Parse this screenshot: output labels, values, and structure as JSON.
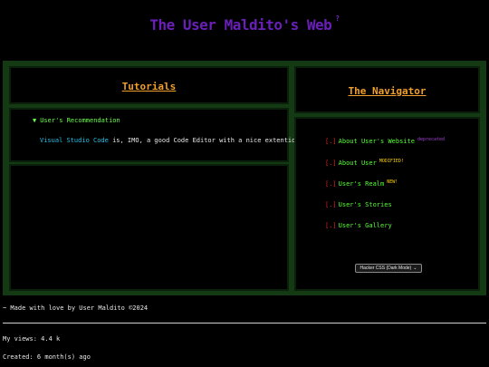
{
  "header": {
    "title": "The User Maldito's Web",
    "sup": "?"
  },
  "tutorials": {
    "title": "Tutorials",
    "details_summary": "User's Recommendation",
    "rec_link": "Visual Studio Code",
    "rec_rest": " is, IMO, a good Code Editor with a nice extention as"
  },
  "navigator": {
    "title": "The Navigator",
    "items": [
      {
        "bracket": "[.]",
        "label": "About User's Website",
        "tag": "deprecated"
      },
      {
        "bracket": "[.]",
        "label": "About User",
        "tag": "MODIFIED!"
      },
      {
        "bracket": "[.]",
        "label": "User's Realm",
        "tag": "NEW!"
      },
      {
        "bracket": "[.]",
        "label": "User's Stories",
        "tag": ""
      },
      {
        "bracket": "[.]",
        "label": "User's Gallery",
        "tag": ""
      }
    ],
    "theme_select": "Hacker CSS (Dark Mode)"
  },
  "footer": {
    "credit": "~ Made with love by User Maldito ©2024",
    "views": "My views: 4.4 k",
    "created": "Created: 6 month(s) ago"
  },
  "colors": {
    "title": "#6a1fb8",
    "panel_title": "#f0a028",
    "link_green": "#55ff33",
    "bracket_red": "#e02020",
    "vscode_cyan": "#22c0e8",
    "frame_green": "#143a14"
  }
}
